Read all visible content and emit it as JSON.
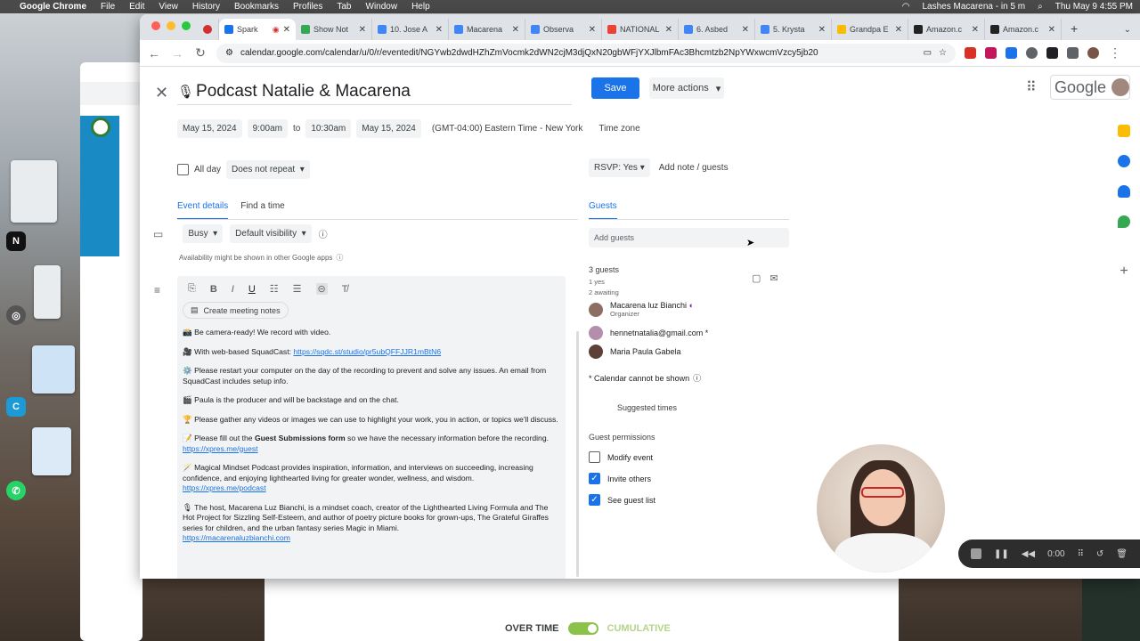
{
  "menubar": {
    "app_name": "Google Chrome",
    "menus": [
      "File",
      "Edit",
      "View",
      "History",
      "Bookmarks",
      "Profiles",
      "Tab",
      "Window",
      "Help"
    ],
    "notification": "Lashes Macarena - in 5 m",
    "clock": "Thu May 9  4:55 PM"
  },
  "browser": {
    "tabs": [
      {
        "label": "Spark",
        "color": "#1a73e8"
      },
      {
        "label": "Show Not",
        "color": "#34a853"
      },
      {
        "label": "10. Jose A",
        "color": "#4285f4"
      },
      {
        "label": "Macarena",
        "color": "#4285f4"
      },
      {
        "label": "Observa",
        "color": "#4285f4"
      },
      {
        "label": "NATIONAL",
        "color": "#ea4335"
      },
      {
        "label": "6. Asbed",
        "color": "#4285f4"
      },
      {
        "label": "5. Krysta",
        "color": "#4285f4"
      },
      {
        "label": "Grandpa E",
        "color": "#fbbc04"
      },
      {
        "label": "Amazon.c",
        "color": "#222222"
      },
      {
        "label": "Amazon.c",
        "color": "#222222"
      }
    ],
    "url": "calendar.google.com/calendar/u/0/r/eventedit/NGYwb2dwdHZhZmVocmk2dWN2cjM3djQxN20gbWFjYXJlbmFAc3Bhcmtzb2NpYWxwcmVzcy5jb20"
  },
  "event": {
    "title_icon": "🎙",
    "title": "Podcast Natalie & Macarena",
    "save_label": "Save",
    "more_actions_label": "More actions",
    "start_date": "May 15, 2024",
    "start_time": "9:00am",
    "to_label": "to",
    "end_time": "10:30am",
    "end_date": "May 15, 2024",
    "timezone": "(GMT-04:00) Eastern Time - New York",
    "timezone_link": "Time zone",
    "all_day_label": "All day",
    "repeat": "Does not repeat",
    "rsvp": "RSVP: Yes",
    "add_note": "Add note / guests"
  },
  "google_logo": "Google",
  "details": {
    "tab_event_details": "Event details",
    "tab_find_time": "Find a time",
    "busy": "Busy",
    "visibility": "Default visibility",
    "availability_note": "Availability might be shown in other Google apps",
    "create_notes": "Create meeting notes",
    "desc": {
      "p1": "📸 Be camera-ready! We record with video.",
      "p2_prefix": "🎥 With web-based SquadCast: ",
      "p2_link": "https://sqdc.st/studio/pr5ubQFFJJR1mBtN6",
      "p3": "⚙️ Please restart your computer on the day of the recording to prevent and solve any issues. An email from SquadCast includes setup info.",
      "p4": "🎬 Paula is the producer and will be backstage and on the chat.",
      "p5": "🏆 Please gather any videos or images we can use to highlight your work, you in action, or topics we'll discuss.",
      "p6_prefix": "📝 Please fill out the ",
      "p6_bold": "Guest Submissions form",
      "p6_suffix": " so we have the necessary information before the recording. ",
      "p6_link": "https://xpres.me/guest",
      "p7": "🪄 Magical Mindset Podcast provides inspiration, information, and interviews on succeeding, increasing confidence, and enjoying lighthearted living for greater wonder, wellness, and wisdom.",
      "p7_link": "https://xpres.me/podcast",
      "p8": "🎙 The host, Macarena Luz Bianchi, is a mindset coach, creator of the Lighthearted Living Formula and The Hot Project for Sizzling Self-Esteem, and author of poetry picture books for grown-ups, The Grateful Giraffes series for children, and the urban fantasy series Magic in Miami.",
      "p8_link": "https://macarenaluzbianchi.com"
    }
  },
  "guests": {
    "tab_label": "Guests",
    "add_placeholder": "Add guests",
    "count": "3 guests",
    "yes": "1 yes",
    "awaiting": "2 awaiting",
    "list": [
      {
        "name": "Macarena luz Bianchi",
        "role": "Organizer",
        "color": "#8d6e63"
      },
      {
        "name": "hennetnatalia@gmail.com *",
        "role": "",
        "color": "#b48ead"
      },
      {
        "name": "Maria Paula Gabela",
        "role": "",
        "color": "#5d4037"
      }
    ],
    "calendar_note": "* Calendar cannot be shown",
    "suggested_times": "Suggested times",
    "permissions_title": "Guest permissions",
    "permissions": [
      {
        "label": "Modify event",
        "checked": false
      },
      {
        "label": "Invite others",
        "checked": true
      },
      {
        "label": "See guest list",
        "checked": true
      }
    ]
  },
  "recorder": {
    "time": "0:00"
  },
  "background": {
    "over_time": "OVER TIME",
    "cumulative": "CUMULATIVE"
  }
}
